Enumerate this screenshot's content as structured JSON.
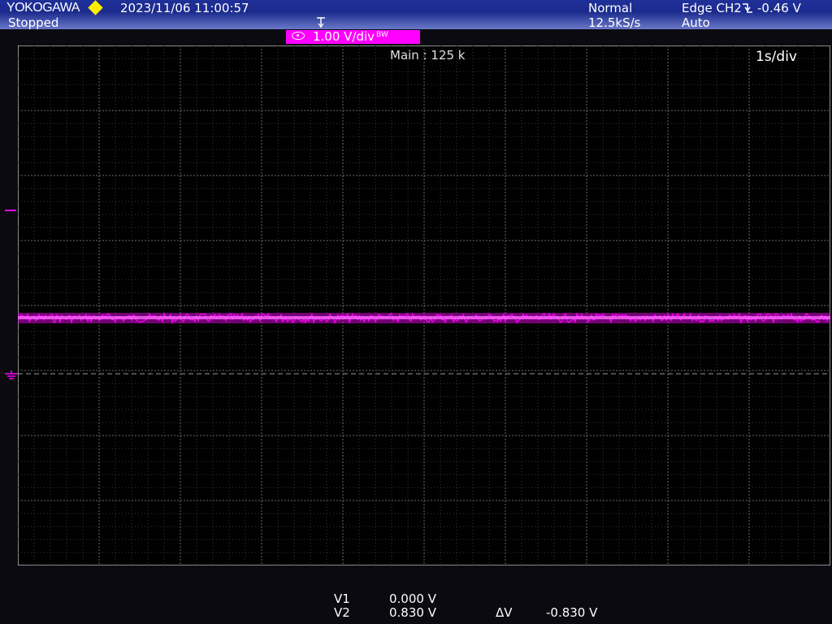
{
  "header": {
    "brand": "YOKOGAWA",
    "datetime": "2023/11/06 11:00:57",
    "status": "Stopped",
    "trigger_mode": "Normal",
    "sample_rate": "12.5kS/s",
    "trigger_source": "Edge CH2",
    "trigger_level": "-0.46 V",
    "trigger_auto": "Auto"
  },
  "channel": {
    "scale": "1.00 V/div",
    "suffix": "BW",
    "color": "#ff00ff"
  },
  "display": {
    "main_record": "Main : 125 k",
    "timebase": "1s/div"
  },
  "cursors": {
    "v1_label": "V1",
    "v1_value": "0.000 V",
    "v2_label": "V2",
    "v2_value": "0.830 V",
    "dv_label": "ΔV",
    "dv_value": "-0.830 V"
  },
  "colors": {
    "trace": "#ff00ff",
    "grid": "#5a5a5a",
    "background": "#000000",
    "header_top": "#1a2a8c"
  }
}
